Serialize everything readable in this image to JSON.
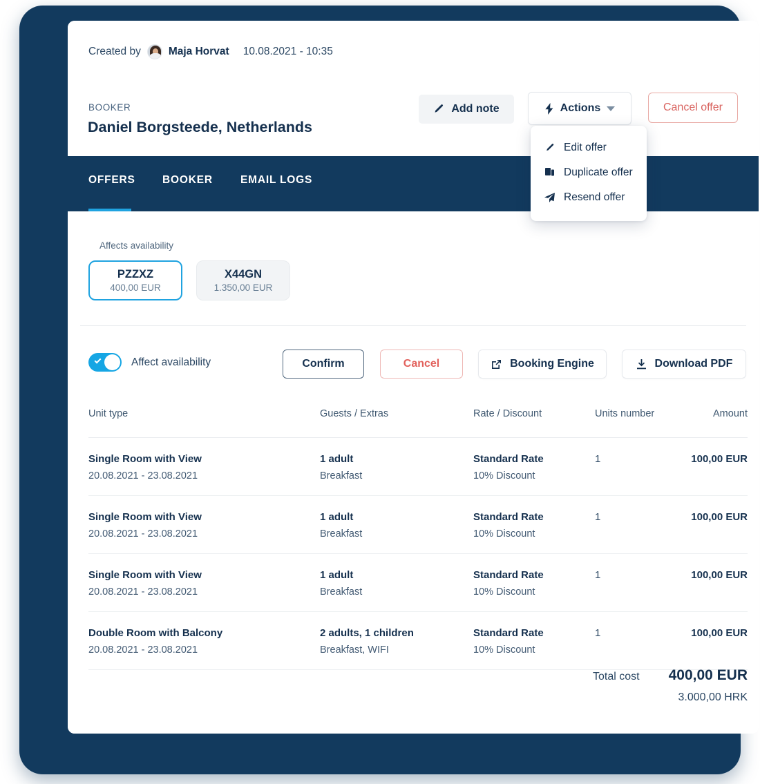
{
  "header": {
    "created_by_label": "Created by",
    "creator_name": "Maja Horvat",
    "created_date": "10.08.2021 - 10:35",
    "booker_label": "BOOKER",
    "booker_name": "Daniel Borgsteede, Netherlands",
    "add_note_label": "Add note",
    "actions_label": "Actions",
    "cancel_offer_label": "Cancel offer"
  },
  "actions_menu": {
    "items": [
      {
        "label": "Edit offer",
        "icon": "pencil-icon"
      },
      {
        "label": "Duplicate offer",
        "icon": "copy-icon"
      },
      {
        "label": "Resend offer",
        "icon": "send-icon"
      }
    ]
  },
  "tabs": [
    {
      "label": "OFFERS",
      "active": true
    },
    {
      "label": "BOOKER",
      "active": false
    },
    {
      "label": "EMAIL LOGS",
      "active": false
    }
  ],
  "offers_panel": {
    "affects_availability_label": "Affects availability",
    "chips": [
      {
        "code": "PZZXZ",
        "amount": "400,00 EUR",
        "selected": true
      },
      {
        "code": "X44GN",
        "amount": "1.350,00 EUR",
        "selected": false
      }
    ],
    "toggle_label": "Affect availability",
    "toggle_on": true,
    "confirm_label": "Confirm",
    "cancel_label": "Cancel",
    "booking_engine_label": "Booking Engine",
    "download_pdf_label": "Download PDF"
  },
  "table": {
    "columns": [
      "Unit type",
      "Guests / Extras",
      "Rate / Discount",
      "Units number",
      "Amount"
    ],
    "rows": [
      {
        "unit_type": "Single Room with View",
        "dates": "20.08.2021 - 23.08.2021",
        "guests": "1 adult",
        "extras": "Breakfast",
        "rate": "Standard Rate",
        "discount": "10% Discount",
        "units": "1",
        "amount": "100,00 EUR"
      },
      {
        "unit_type": "Single Room with View",
        "dates": "20.08.2021 - 23.08.2021",
        "guests": "1 adult",
        "extras": "Breakfast",
        "rate": "Standard Rate",
        "discount": "10% Discount",
        "units": "1",
        "amount": "100,00 EUR"
      },
      {
        "unit_type": "Single Room with View",
        "dates": "20.08.2021 - 23.08.2021",
        "guests": "1 adult",
        "extras": "Breakfast",
        "rate": "Standard Rate",
        "discount": "10% Discount",
        "units": "1",
        "amount": "100,00 EUR"
      },
      {
        "unit_type": "Double Room with Balcony",
        "dates": "20.08.2021 - 23.08.2021",
        "guests": "2 adults, 1 children",
        "extras": "Breakfast, WIFI",
        "rate": "Standard Rate",
        "discount": "10% Discount",
        "units": "1",
        "amount": "100,00 EUR"
      }
    ]
  },
  "totals": {
    "label": "Total cost",
    "primary": "400,00 EUR",
    "secondary": "3.000,00 HRK"
  },
  "colors": {
    "navy": "#123a5e",
    "accent_cyan": "#1fa3e0",
    "toggle_on": "#16a6e4",
    "danger": "#d9635f",
    "text_dark": "#15304e",
    "muted": "#51687f",
    "rule": "#e9ecef"
  }
}
